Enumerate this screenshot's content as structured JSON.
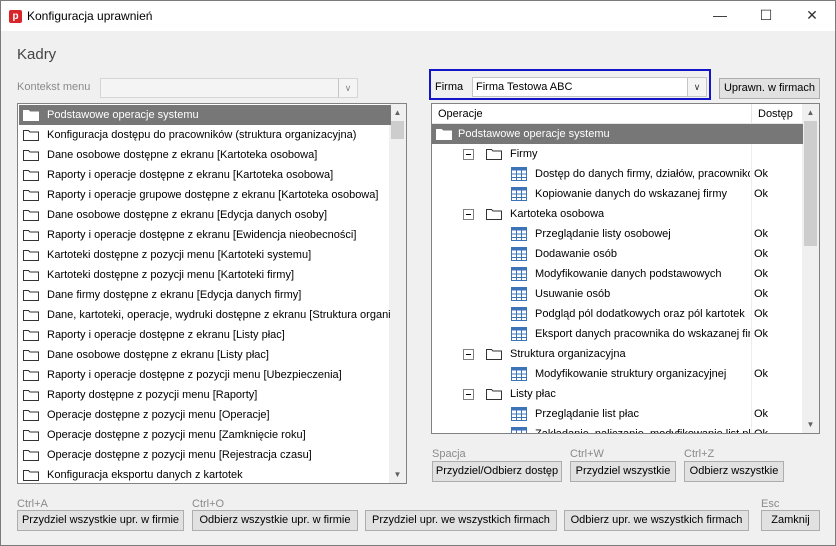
{
  "window": {
    "title": "Konfiguracja uprawnień",
    "app_icon": "p"
  },
  "heading": "Kadry",
  "kontekst": {
    "label": "Kontekst menu",
    "value": ""
  },
  "firma": {
    "label": "Firma",
    "value": "Firma Testowa ABC"
  },
  "uprawn_button": "Uprawn. w firmach",
  "left_list": [
    "Podstawowe operacje systemu",
    "Konfiguracja dostępu do pracowników (struktura organizacyjna)",
    "Dane osobowe dostępne z ekranu [Kartoteka osobowa]",
    "Raporty i operacje dostępne z ekranu [Kartoteka osobowa]",
    "Raporty i operacje grupowe dostępne z ekranu [Kartoteka osobowa]",
    "Dane osobowe dostępne z ekranu [Edycja danych osoby]",
    "Raporty i operacje dostępne z ekranu [Ewidencja nieobecności]",
    "Kartoteki dostępne z pozycji menu [Kartoteki systemu]",
    "Kartoteki dostępne z pozycji menu [Kartoteki firmy]",
    "Dane firmy dostępne z ekranu [Edycja danych firmy]",
    "Dane, kartoteki, operacje, wydruki dostępne z ekranu [Struktura organiz",
    "Raporty i operacje dostępne z ekranu [Listy płac]",
    "Dane osobowe dostępne z ekranu [Listy płac]",
    "Raporty i operacje dostępne z pozycji menu [Ubezpieczenia]",
    "Raporty dostępne z pozycji menu [Raporty]",
    "Operacje dostępne z pozycji menu [Operacje]",
    "Operacje dostępne z pozycji menu [Zamknięcie roku]",
    "Operacje dostępne z pozycji menu [Rejestracja czasu]",
    "Konfiguracja eksportu danych z kartotek"
  ],
  "tree": {
    "col_operacje": "Operacje",
    "col_dostep": "Dostęp",
    "root": "Podstawowe operacje systemu",
    "groups": [
      {
        "name": "Firmy",
        "items": [
          {
            "label": "Dostęp do danych firmy, działów, pracowników",
            "access": "Ok"
          },
          {
            "label": "Kopiowanie danych do wskazanej firmy",
            "access": "Ok"
          }
        ]
      },
      {
        "name": "Kartoteka osobowa",
        "items": [
          {
            "label": "Przeglądanie listy osobowej",
            "access": "Ok"
          },
          {
            "label": "Dodawanie osób",
            "access": "Ok"
          },
          {
            "label": "Modyfikowanie danych podstawowych",
            "access": "Ok"
          },
          {
            "label": "Usuwanie osób",
            "access": "Ok"
          },
          {
            "label": "Podgląd pól dodatkowych oraz pól kartotek",
            "access": "Ok"
          },
          {
            "label": "Eksport danych pracownika do wskazanej firmy",
            "access": "Ok"
          }
        ]
      },
      {
        "name": "Struktura organizacyjna",
        "items": [
          {
            "label": "Modyfikowanie struktury organizacyjnej",
            "access": "Ok"
          }
        ]
      },
      {
        "name": "Listy płac",
        "items": [
          {
            "label": "Przeglądanie list płac",
            "access": "Ok"
          },
          {
            "label": "Zakładanie, naliczanie, modyfikowanie list płac",
            "access": "Ok"
          }
        ]
      }
    ]
  },
  "actions_right": [
    {
      "shortcut": "Spacja",
      "label": "Przydziel/Odbierz dostęp"
    },
    {
      "shortcut": "Ctrl+W",
      "label": "Przydziel wszystkie"
    },
    {
      "shortcut": "Ctrl+Z",
      "label": "Odbierz wszystkie"
    }
  ],
  "actions_bottom": [
    {
      "shortcut": "Ctrl+A",
      "label": "Przydziel wszystkie upr. w firmie"
    },
    {
      "shortcut": "Ctrl+O",
      "label": "Odbierz wszystkie upr. w firmie"
    },
    {
      "shortcut": "",
      "label": "Przydziel upr. we wszystkich firmach"
    },
    {
      "shortcut": "",
      "label": "Odbierz upr. we wszystkich firmach"
    },
    {
      "shortcut": "Esc",
      "label": "Zamknij"
    }
  ],
  "colors": {
    "selection": "#777777",
    "firma_frame": "#1414c8",
    "app_icon": "#d8252b"
  }
}
